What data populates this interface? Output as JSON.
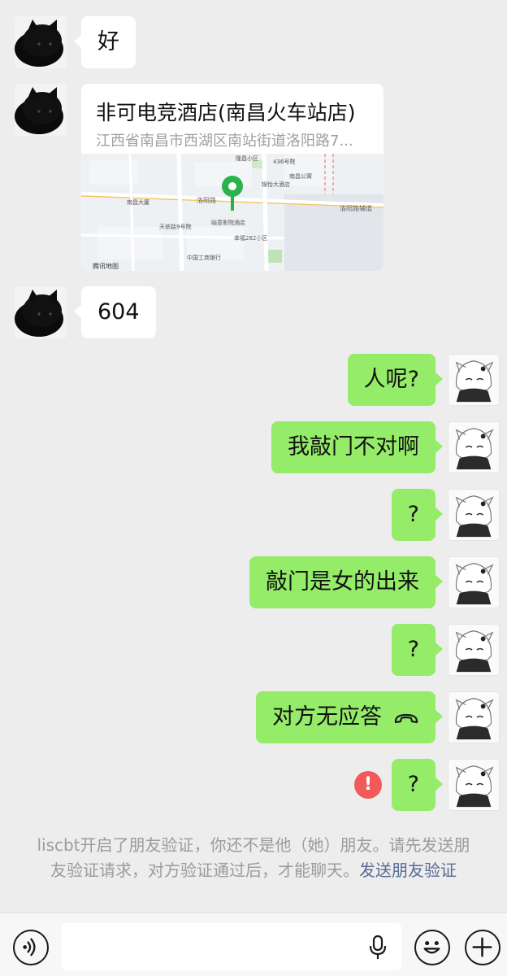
{
  "messages": [
    {
      "side": "in",
      "text": "好"
    },
    {
      "side": "in",
      "type": "location",
      "title": "非可电竞酒店(南昌火车站店)",
      "address": "江西省南昌市西湖区南站街道洛阳路7..."
    },
    {
      "side": "in",
      "text": "604"
    },
    {
      "side": "out",
      "text": "人呢?"
    },
    {
      "side": "out",
      "text": "我敲门不对啊"
    },
    {
      "side": "out",
      "text": "?"
    },
    {
      "side": "out",
      "text": "敲门是女的出来"
    },
    {
      "side": "out",
      "text": "?"
    },
    {
      "side": "out",
      "text": "对方无应答"
    },
    {
      "side": "out",
      "text": "?",
      "status": "failed"
    }
  ],
  "map_labels": {
    "road_main": "洛阳路",
    "road_east": "洛阳路辅道",
    "poi_hotel": "喻意影院酒店",
    "poi_tengxun": "腾讯地图",
    "poi_436": "436号院",
    "poi_nancheng": "南昌大厦",
    "poi_tianyi": "天依路9号院",
    "poi_bank": "中国工商银行",
    "poi_xingfu": "幸福282小区",
    "poi_longyuan": "隆昌小区",
    "poi_jinhui": "锦怡大酒店",
    "poi_nanjing": "南昌公寓",
    "poi_chuan": "天依路9号院"
  },
  "system_note": {
    "text": "liscbt开启了朋友验证，你还不是他（她）朋友。请先发送朋友验证请求，对方验证通过后，才能聊天。",
    "link": "发送朋友验证"
  },
  "error_mark": "!",
  "input": {
    "value": "",
    "placeholder": ""
  },
  "colors": {
    "background": "#ededed",
    "bubble_out": "#95ec69",
    "bubble_in": "#ffffff",
    "link": "#576b95",
    "error": "#f15a58",
    "map_pin": "#2bb24c"
  },
  "icons": {
    "voice": "voice-mode-icon",
    "mic": "microphone-icon",
    "emoji": "emoji-icon",
    "plus": "plus-icon",
    "call": "phone-hangup-icon",
    "pin": "map-pin-icon"
  }
}
